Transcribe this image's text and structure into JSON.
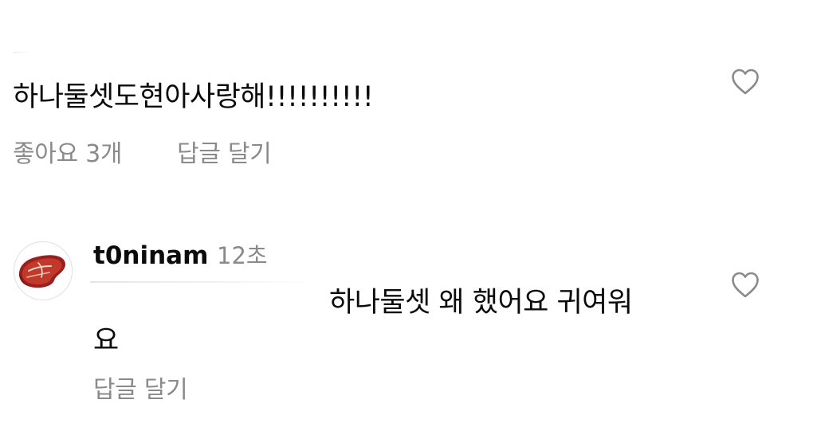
{
  "comments": [
    {
      "text": "하나둘셋도현아사랑해!!!!!!!!!!",
      "likes_label": "좋아요 3개",
      "reply_label": "답글 달기",
      "like_icon": "heart-outline-icon"
    },
    {
      "avatar_icon": "steak-avatar-image",
      "username": "t0ninam",
      "time": "12초",
      "text_line1": "하나둘셋 왜 했어요 귀여워",
      "text_line2": "요",
      "reply_label": "답글 달기",
      "like_icon": "heart-outline-icon"
    }
  ],
  "colors": {
    "text": "#0b0b0b",
    "secondary": "#8a8a8a",
    "background": "#ffffff"
  }
}
